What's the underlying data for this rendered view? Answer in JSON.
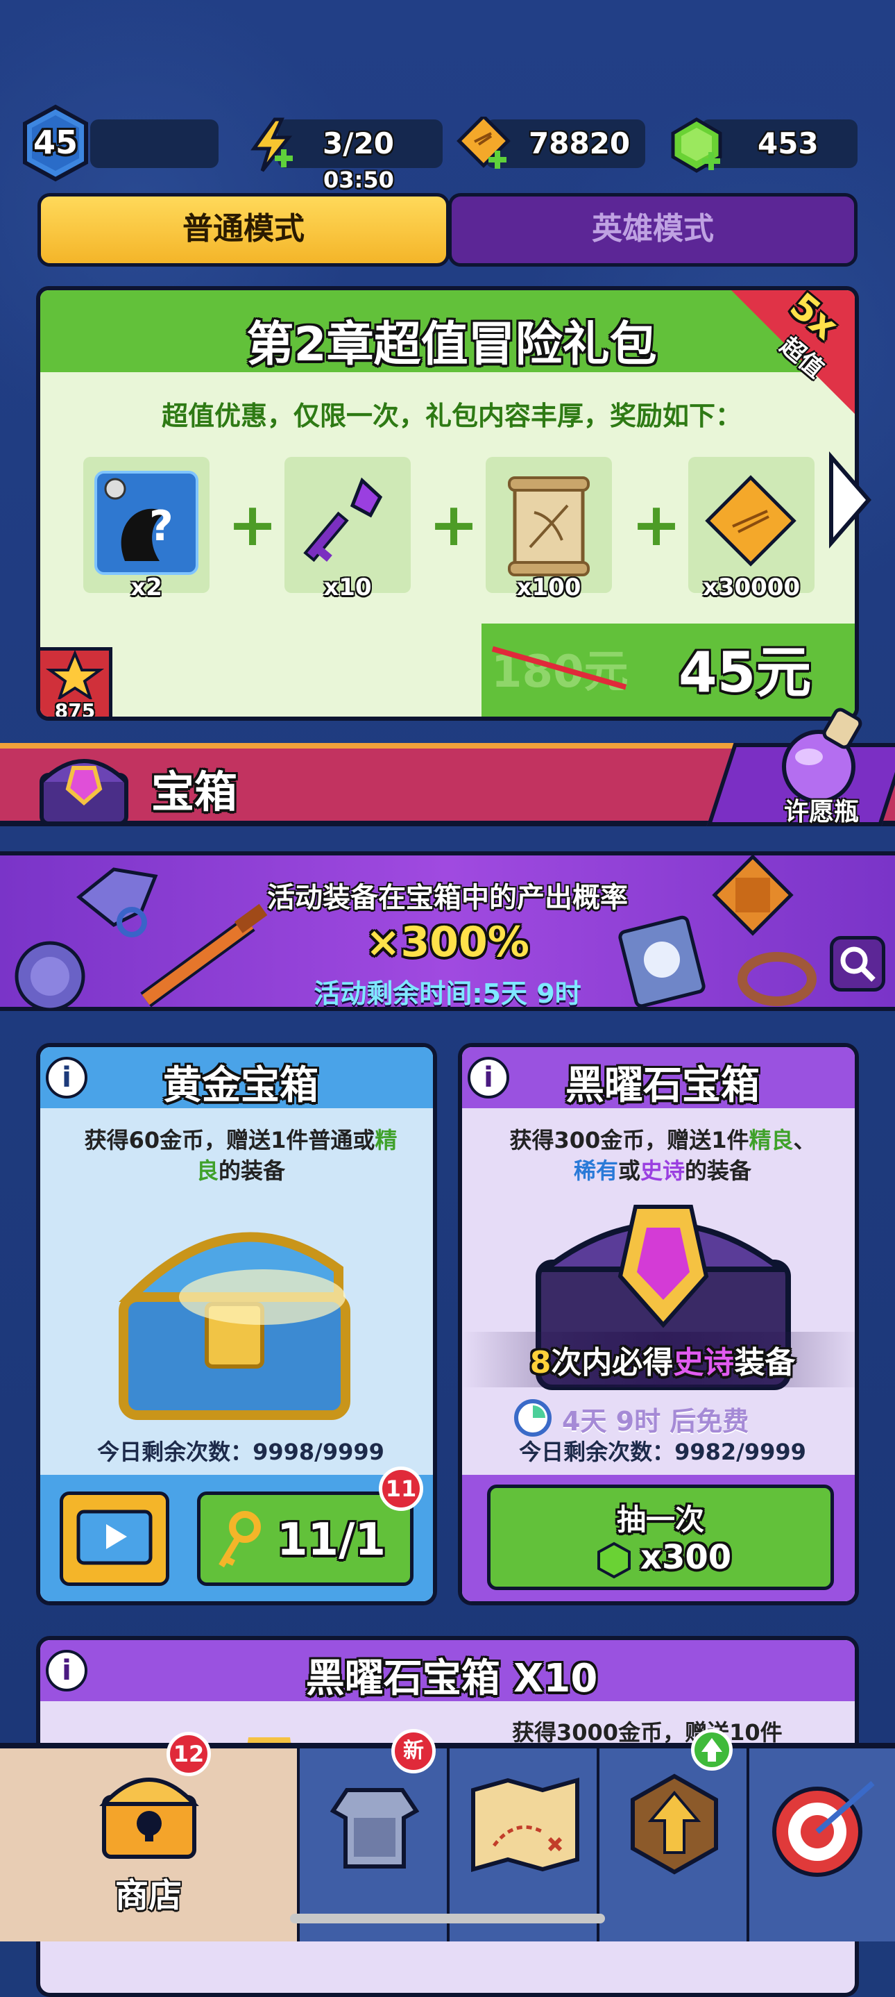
{
  "top_bar": {
    "level": "45",
    "energy": "3/20",
    "energy_timer": "03:50",
    "coins": "78820",
    "gems": "453"
  },
  "mode_tabs": [
    "普通模式",
    "英雄模式"
  ],
  "gift_pack": {
    "title": "第2章超值冒险礼包",
    "ribbon_multiplier": "5x",
    "ribbon_label": "超值",
    "subtitle": "超值优惠，仅限一次，礼包内容丰厚，奖励如下：",
    "items": [
      {
        "icon": "mystery-equipment-icon",
        "qty": "x2"
      },
      {
        "icon": "purple-key-icon",
        "qty": "x10"
      },
      {
        "icon": "design-scroll-icon",
        "qty": "x100"
      },
      {
        "icon": "gold-coin-icon",
        "qty": "x30000"
      }
    ],
    "badge_value": "875",
    "old_price": "180元",
    "price": "45元"
  },
  "section": {
    "title": "宝箱",
    "wish_bottle": "许愿瓶"
  },
  "event_banner": {
    "line1": "活动装备在宝箱中的产出概率",
    "multiplier": "×300%",
    "remaining": "活动剩余时间:5天 9时"
  },
  "gold_chest": {
    "title": "黄金宝箱",
    "desc_a": "获得60金币，赠送1件普通或",
    "desc_b": "精",
    "desc_c": "良",
    "desc_d": "的装备",
    "remaining": "今日剩余次数：9998/9999",
    "key_count": "11/1",
    "key_badge": "11"
  },
  "obsidian_chest": {
    "title": "黑曜石宝箱",
    "desc_a": "获得300金币，赠送1件",
    "desc_b": "精良",
    "desc_c": "、",
    "desc_d": "稀有",
    "desc_e": "或",
    "desc_f": "史诗",
    "desc_g": "的装备",
    "guarantee_a": "8",
    "guarantee_b": "次内必得",
    "guarantee_c": "史诗",
    "guarantee_d": "装备",
    "free_timer": "4天 9时 后免费",
    "remaining": "今日剩余次数：9982/9999",
    "draw_label": "抽一次",
    "draw_cost": "x300"
  },
  "obsidian_chest_x10": {
    "title": "黑曜石宝箱 X10",
    "desc": "获得3000金币，赠送10件"
  },
  "bottom_nav": {
    "shop_label": "商店",
    "shop_badge": "12",
    "equip_badge": "新"
  },
  "colors": {
    "green": "#62c13a",
    "purple": "#7b2fc4",
    "gold": "#f5c242",
    "blue": "#4aa3e8",
    "red": "#d92b3a"
  }
}
